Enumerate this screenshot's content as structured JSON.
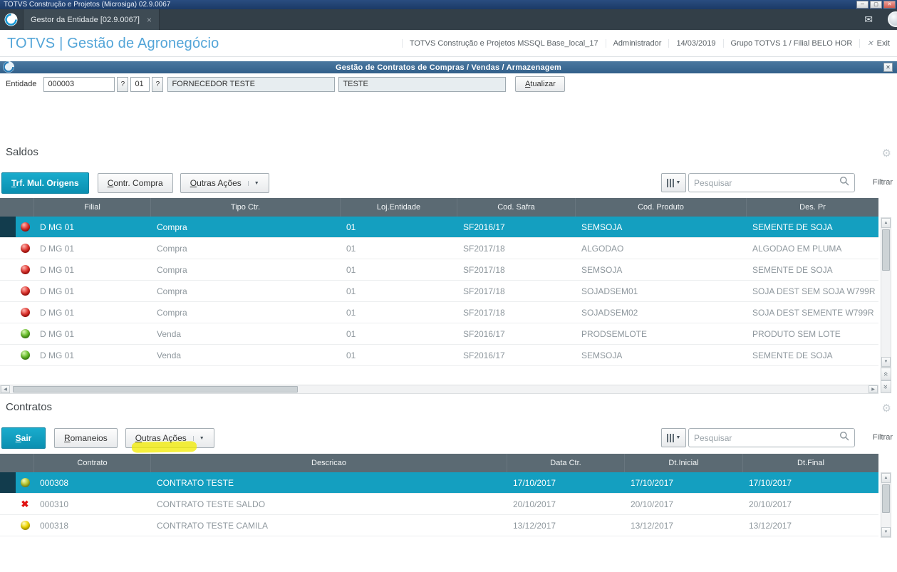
{
  "window": {
    "title": "TOTVS Construção e Projetos (Microsiga) 02.9.0067"
  },
  "tab_bar": {
    "active_tab": "Gestor da Entidade [02.9.0067]",
    "close_glyph": "×"
  },
  "header": {
    "brand": "TOTVS | Gestão de Agronegócio",
    "environment": "TOTVS Construção e Projetos MSSQL Base_local_17",
    "user": "Administrador",
    "date": "14/03/2019",
    "branch": "Grupo TOTVS 1 / Filial BELO HOR",
    "exit_label": "Exit"
  },
  "dialog": {
    "title": "Gestão de Contratos de Compras / Vendas / Armazenagem"
  },
  "form": {
    "label": "Entidade",
    "code": "000003",
    "lookup": "?",
    "store": "01",
    "name": "FORNECEDOR TESTE",
    "short_name": "TESTE",
    "update_button": "Atualizar"
  },
  "saldos": {
    "title": "Saldos",
    "toolbar": {
      "primary": "Trf. Mul. Origens",
      "secondary": "Contr. Compra",
      "menu": "Outras Ações"
    },
    "search_placeholder": "Pesquisar",
    "filter_label": "Filtrar",
    "columns": [
      "Filial",
      "Tipo Ctr.",
      "Loj.Entidade",
      "Cod. Safra",
      "Cod. Produto",
      "Des. Pr"
    ],
    "rows": [
      {
        "status": "red",
        "cells": [
          "D MG 01",
          "Compra",
          "01",
          "SF2016/17",
          "SEMSOJA",
          "SEMENTE DE SOJA"
        ]
      },
      {
        "status": "red",
        "cells": [
          "D MG 01",
          "Compra",
          "01",
          "SF2017/18",
          "ALGODAO",
          "ALGODAO EM PLUMA"
        ]
      },
      {
        "status": "red",
        "cells": [
          "D MG 01",
          "Compra",
          "01",
          "SF2017/18",
          "SEMSOJA",
          "SEMENTE DE SOJA"
        ]
      },
      {
        "status": "red",
        "cells": [
          "D MG 01",
          "Compra",
          "01",
          "SF2017/18",
          "SOJADSEM01",
          "SOJA DEST SEM SOJA W799R"
        ]
      },
      {
        "status": "red",
        "cells": [
          "D MG 01",
          "Compra",
          "01",
          "SF2017/18",
          "SOJADSEM02",
          "SOJA DEST SEMENTE W799R"
        ]
      },
      {
        "status": "green",
        "cells": [
          "D MG 01",
          "Venda",
          "01",
          "SF2016/17",
          "PRODSEMLOTE",
          "PRODUTO SEM LOTE"
        ]
      },
      {
        "status": "green",
        "cells": [
          "D MG 01",
          "Venda",
          "01",
          "SF2016/17",
          "SEMSOJA",
          "SEMENTE DE SOJA"
        ]
      }
    ]
  },
  "contratos": {
    "title": "Contratos",
    "toolbar": {
      "primary": "Sair",
      "secondary": "Romaneios",
      "menu": "Outras Ações"
    },
    "search_placeholder": "Pesquisar",
    "filter_label": "Filtrar",
    "columns": [
      "Contrato",
      "Descricao",
      "Data Ctr.",
      "Dt.Inicial",
      "Dt.Final"
    ],
    "rows": [
      {
        "status": "olive",
        "cells": [
          "000308",
          "CONTRATO TESTE",
          "17/10/2017",
          "17/10/2017",
          "17/10/2017"
        ]
      },
      {
        "status": "xmark",
        "cells": [
          "000310",
          "CONTRATO TESTE SALDO",
          "20/10/2017",
          "20/10/2017",
          "20/10/2017"
        ]
      },
      {
        "status": "yellow",
        "cells": [
          "000318",
          "CONTRATO TESTE CAMILA",
          "13/12/2017",
          "13/12/2017",
          "13/12/2017"
        ]
      }
    ]
  },
  "colors": {
    "accent_teal": "#0f9dbd",
    "selected_row": "#149fc0",
    "table_header_gray": "#5b6a73",
    "brand_blue": "#53a5d8",
    "highlight_yellow": "#f2ec06",
    "status_red": "#c40000",
    "status_green": "#4c9e1d",
    "status_yellow": "#e3cc00"
  }
}
